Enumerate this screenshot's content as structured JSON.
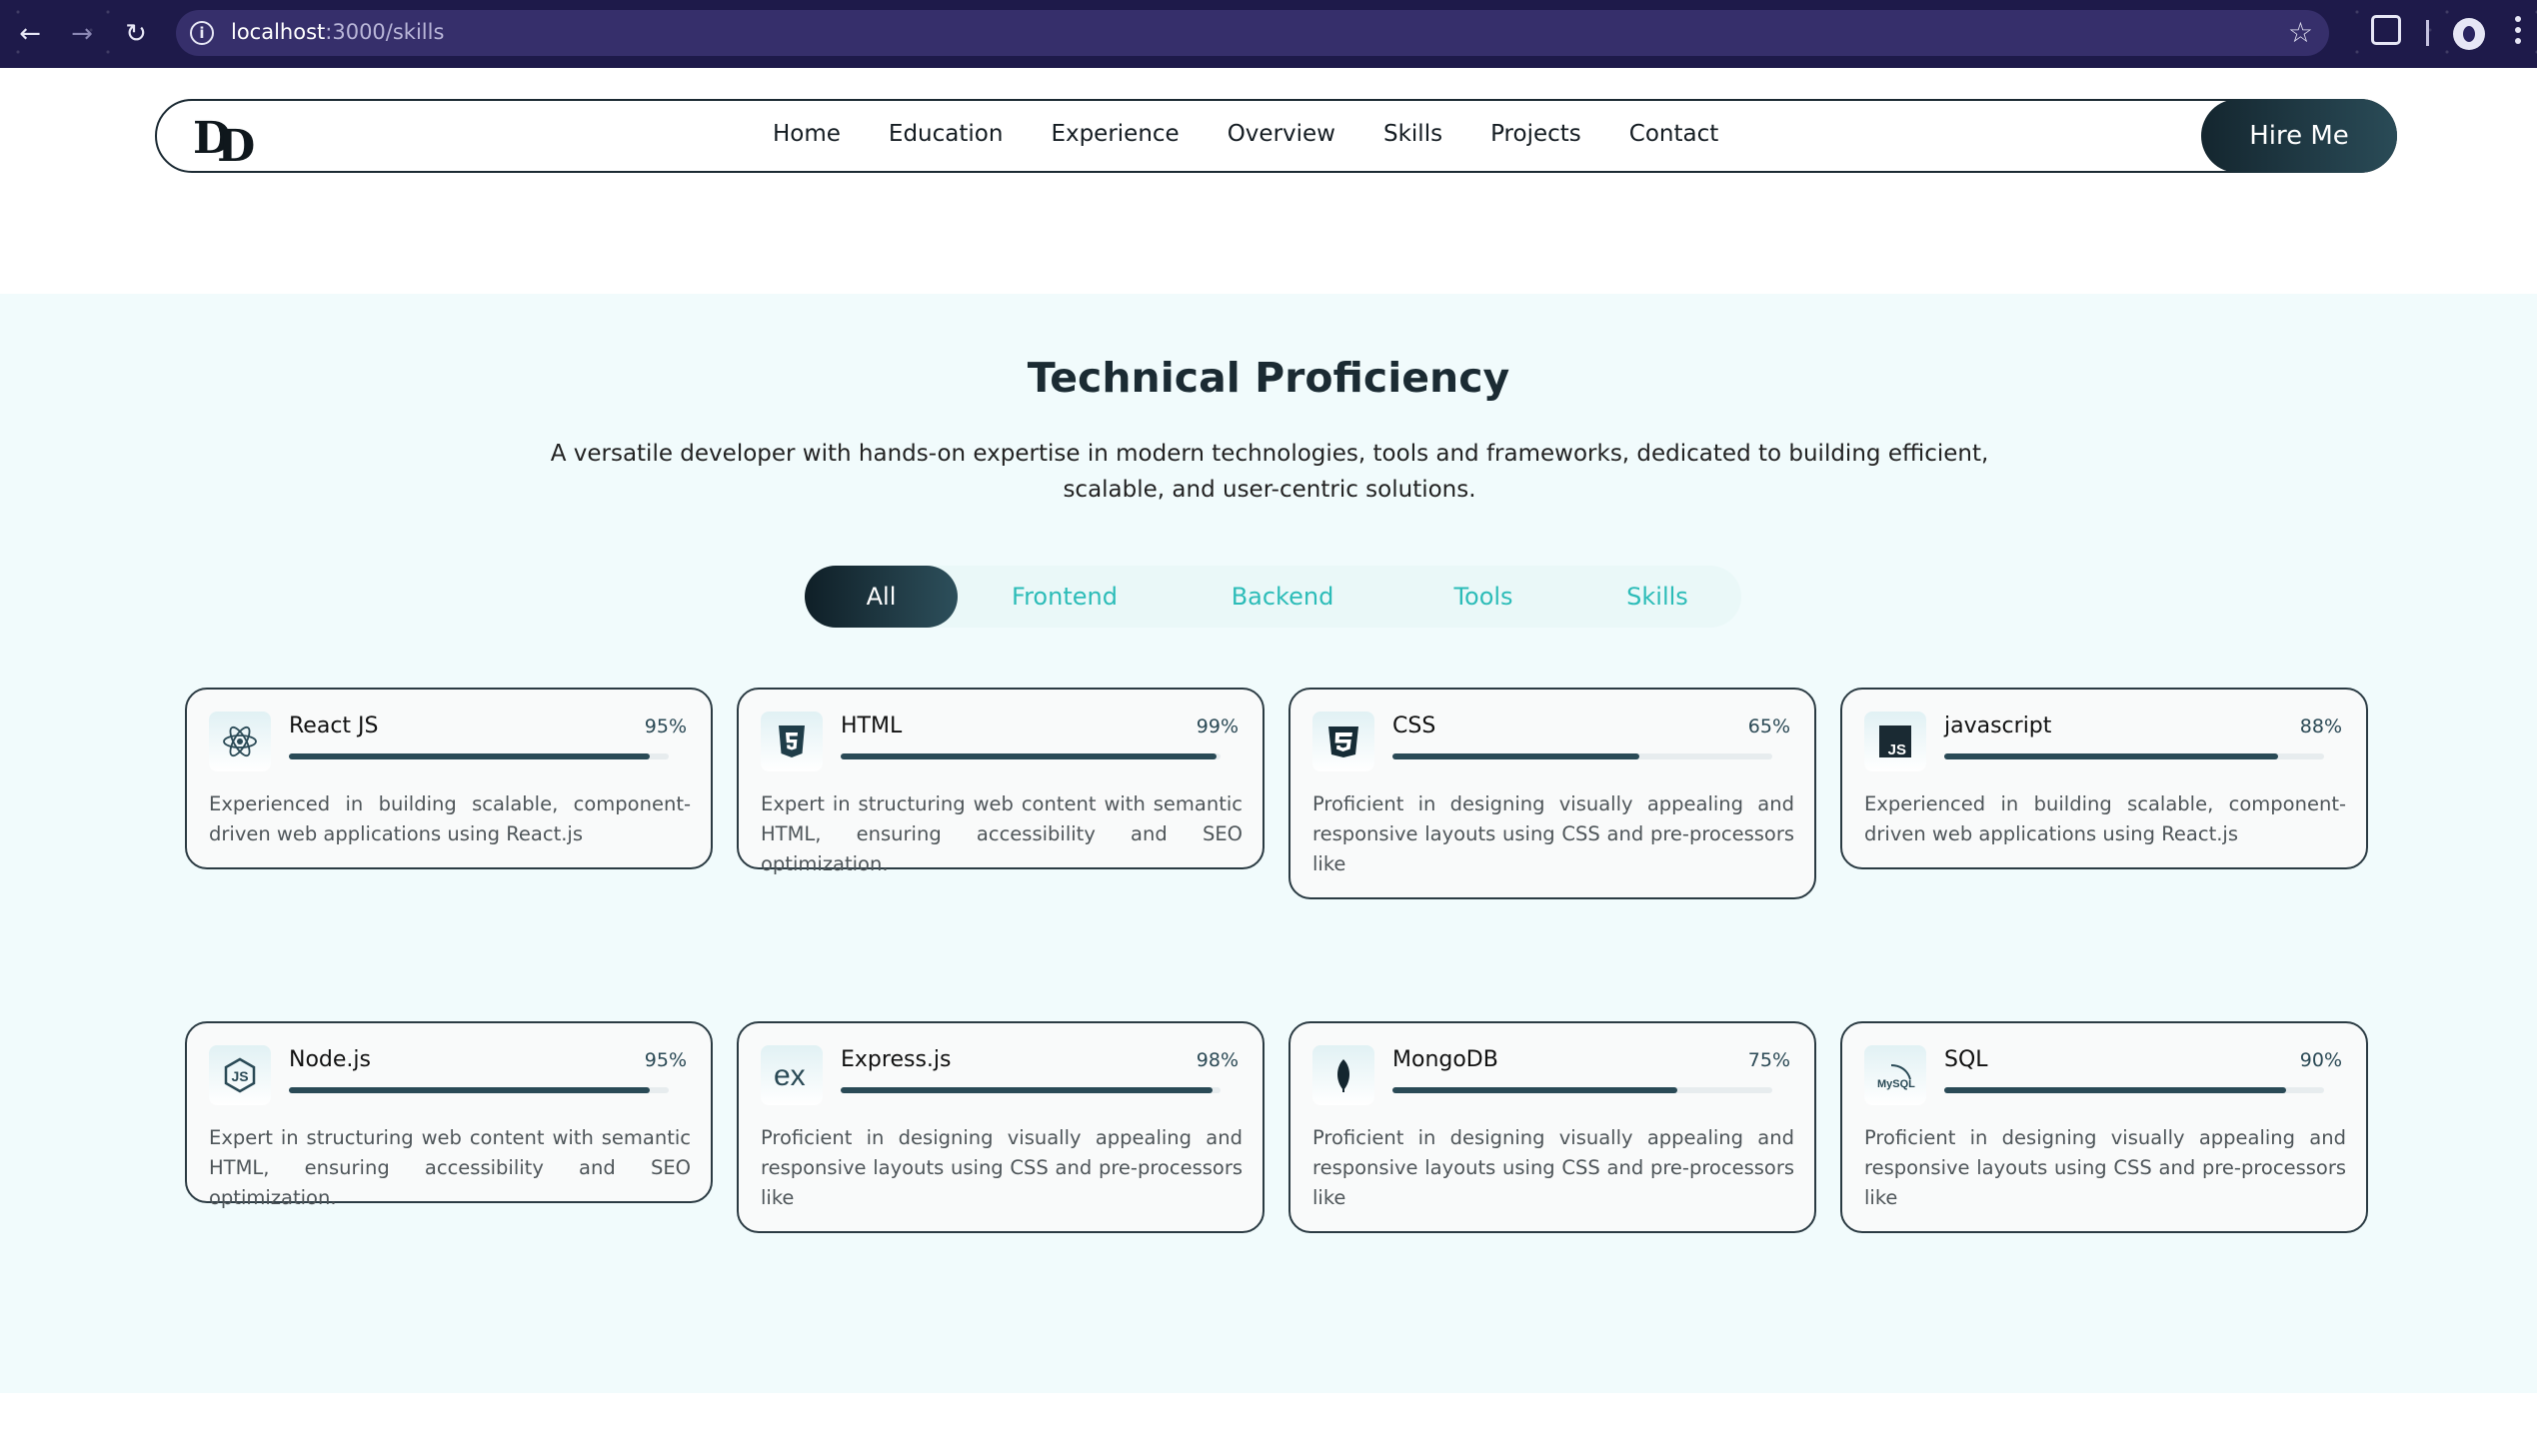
{
  "browser": {
    "url_host": "localhost",
    "url_path": ":3000/skills",
    "info_icon": "info-icon",
    "star_icon": "star-icon"
  },
  "nav": {
    "logo_left": "D",
    "logo_right": "D",
    "items": [
      "Home",
      "Education",
      "Experience",
      "Overview",
      "Skills",
      "Projects",
      "Contact"
    ],
    "cta": "Hire Me"
  },
  "section": {
    "title": "Technical Proficiency",
    "subtitle": "A versatile developer with hands-on expertise in modern technologies, tools and frameworks, dedicated to building efficient, scalable, and user-centric solutions."
  },
  "tabs": [
    "All",
    "Frontend",
    "Backend",
    "Tools",
    "Skills"
  ],
  "active_tab": "All",
  "skills": [
    {
      "name": "React JS",
      "percent_label": "95%",
      "percent": 95,
      "icon": "react-icon",
      "desc": "Experienced in building scalable, component-driven web applications using React.js"
    },
    {
      "name": "HTML",
      "percent_label": "99%",
      "percent": 99,
      "icon": "html5-icon",
      "desc": "Expert in structuring web content with semantic HTML, ensuring accessibility and SEO optimization."
    },
    {
      "name": "CSS",
      "percent_label": "65%",
      "percent": 65,
      "icon": "css3-icon",
      "desc": "Proficient in designing visually appealing and responsive layouts using CSS and pre-processors like"
    },
    {
      "name": "javascript",
      "percent_label": "88%",
      "percent": 88,
      "icon": "javascript-icon",
      "desc": "Experienced in building scalable, component-driven web applications using React.js"
    },
    {
      "name": "Node.js",
      "percent_label": "95%",
      "percent": 95,
      "icon": "nodejs-icon",
      "desc": "Expert in structuring web content with semantic HTML, ensuring accessibility and SEO optimization."
    },
    {
      "name": "Express.js",
      "percent_label": "98%",
      "percent": 98,
      "icon": "express-icon",
      "desc": "Proficient in designing visually appealing and responsive layouts using CSS and pre-processors like"
    },
    {
      "name": "MongoDB",
      "percent_label": "75%",
      "percent": 75,
      "icon": "mongodb-icon",
      "desc": "Proficient in designing visually appealing and responsive layouts using CSS and pre-processors like"
    },
    {
      "name": "SQL",
      "percent_label": "90%",
      "percent": 90,
      "icon": "mysql-icon",
      "desc": "Proficient in designing visually appealing and responsive layouts using CSS and pre-processors like"
    }
  ],
  "icon_text": {
    "js": "JS",
    "express": "ex",
    "mysql": "MySQL"
  },
  "colors": {
    "accent": "#2cbcb8",
    "dark": "#1b2b33",
    "bar": "#2a4a56",
    "section_bg": "#f1fbfc"
  }
}
